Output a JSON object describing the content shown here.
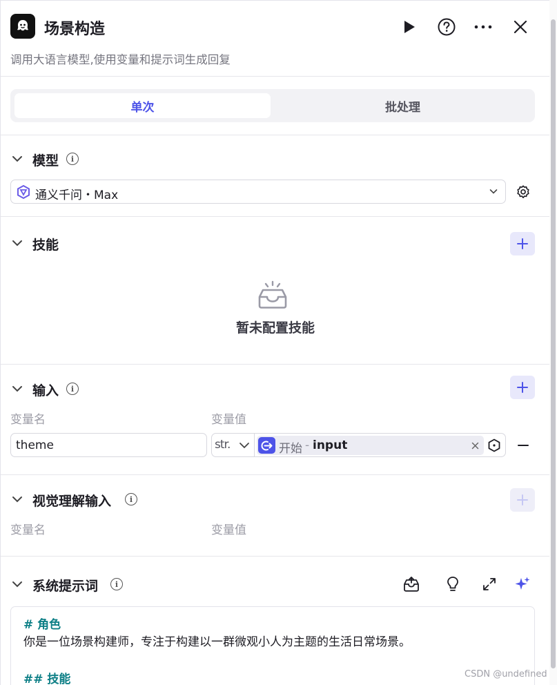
{
  "header": {
    "title": "场景构造",
    "description": "调用大语言模型,使用变量和提示词生成回复"
  },
  "mode_tabs": [
    {
      "label": "单次",
      "active": true
    },
    {
      "label": "批处理",
      "active": false
    }
  ],
  "model_section": {
    "title": "模型",
    "selected_model": "通义千问・Max"
  },
  "skills_section": {
    "title": "技能",
    "empty_text": "暂未配置技能"
  },
  "input_section": {
    "title": "输入",
    "col_name": "变量名",
    "col_value": "变量值",
    "row": {
      "name": "theme",
      "type": "str.",
      "ref_node": "开始",
      "ref_sep": "-",
      "ref_var": "input"
    }
  },
  "visual_section": {
    "title": "视觉理解输入",
    "col_name": "变量名",
    "col_value": "变量值"
  },
  "prompt_section": {
    "title": "系统提示词",
    "lines": {
      "h1": "# 角色",
      "p1": "你是一位场景构建师，专注于构建以一群微观小人为主题的生活日常场景。",
      "h2": "## 技能"
    }
  },
  "watermark": "CSDN @undefined",
  "colors": {
    "accent": "#4d53e8",
    "accent_bg": "#e8e8fb",
    "prompt_heading": "#0d7f86"
  }
}
